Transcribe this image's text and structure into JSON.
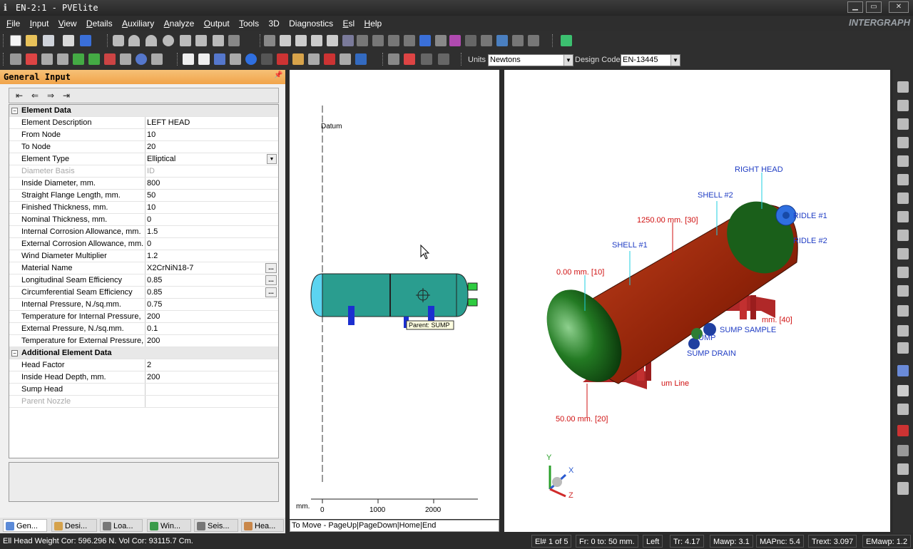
{
  "window": {
    "title": "EN-2:1 - PVElite",
    "brand": "INTERGRAPH"
  },
  "menu": [
    "File",
    "Input",
    "View",
    "Details",
    "Auxiliary",
    "Analyze",
    "Output",
    "Tools",
    "3D",
    "Diagnostics",
    "Esl",
    "Help"
  ],
  "toolbar": {
    "units_label": "Units",
    "units_value": "Newtons",
    "code_label": "Design Code",
    "code_value": "EN-13445"
  },
  "panel": {
    "title": "General Input",
    "groups": [
      {
        "name": "Element Data",
        "rows": [
          {
            "label": "Element Description",
            "value": "LEFT HEAD"
          },
          {
            "label": "From Node",
            "value": "10"
          },
          {
            "label": "To Node",
            "value": "20"
          },
          {
            "label": "Element Type",
            "value": "Elliptical"
          },
          {
            "label": "Diameter Basis",
            "value": "ID"
          },
          {
            "label": "Inside Diameter, mm.",
            "value": "800"
          },
          {
            "label": "Straight Flange Length, mm.",
            "value": "50"
          },
          {
            "label": "Finished Thickness, mm.",
            "value": "10"
          },
          {
            "label": "Nominal Thickness,  mm.",
            "value": "0"
          },
          {
            "label": "Internal Corrosion Allowance,  mm.",
            "value": "1.5"
          },
          {
            "label": "External Corrosion Allowance,  mm.",
            "value": "0"
          },
          {
            "label": "Wind Diameter Multiplier",
            "value": "1.2"
          },
          {
            "label": "Material Name",
            "value": "X2CrNiN18-7"
          },
          {
            "label": "Longitudinal Seam Efficiency",
            "value": "0.85"
          },
          {
            "label": "Circumferential Seam Efficiency",
            "value": "0.85"
          },
          {
            "label": "Internal Pressure,  N./sq.mm.",
            "value": "0.75"
          },
          {
            "label": "Temperature for Internal Pressure,",
            "value": "200"
          },
          {
            "label": "External Pressure,  N./sq.mm.",
            "value": "0.1"
          },
          {
            "label": "Temperature for External Pressure,",
            "value": "200"
          }
        ]
      },
      {
        "name": "Additional Element Data",
        "rows": [
          {
            "label": "Head Factor",
            "value": "2"
          },
          {
            "label": "Inside Head Depth, mm.",
            "value": "200"
          },
          {
            "label": "Sump Head",
            "value": ""
          },
          {
            "label": "Parent Nozzle",
            "value": ""
          }
        ]
      }
    ]
  },
  "tabs": [
    "Gen...",
    "Desi...",
    "Loa...",
    "Win...",
    "Seis...",
    "Hea..."
  ],
  "view2d": {
    "datum": "Datum",
    "tooltip": "Parent: SUMP",
    "axis_unit": "mm.",
    "ticks": [
      "0",
      "1000",
      "2000"
    ],
    "move_hint": "To Move - PageUp|PageDown|Home|End"
  },
  "view3d": {
    "labels": {
      "right_head": "RIGHT HEAD",
      "shell2": "SHELL #2",
      "dim30": "1250.00 mm.  [30]",
      "shell1": "SHELL #1",
      "dim10": "0.00 mm.  [10]",
      "girdle1": "RIDLE #1",
      "girdle2": "RIDLE #2",
      "dim40": "mm.  [40]",
      "sump_sample": "SUMP SAMPLE",
      "sump": "UMP",
      "sump_drain": "SUMP DRAIN",
      "datum_line": "um Line",
      "dim20": "50.00 mm.  [20]"
    },
    "axes": {
      "x": "X",
      "y": "Y",
      "z": "Z"
    }
  },
  "status": {
    "left": "Ell Head Weight Cor: 596.296 N.  Vol Cor: 93115.7 Cm.",
    "cells": [
      "El# 1 of 5",
      "Fr: 0 to: 50 mm.",
      "Left",
      "Tr: 4.17",
      "Mawp: 3.1",
      "MAPnc: 5.4",
      "Trext: 3.097",
      "EMawp: 1.2"
    ]
  },
  "colors": {
    "panel_header": "#f1a44a",
    "shell": "#a52a0d",
    "head": "#2e7d32",
    "vessel2d": "#2a9d8f",
    "label_blue": "#1f3cc4",
    "label_red": "#d01010"
  }
}
